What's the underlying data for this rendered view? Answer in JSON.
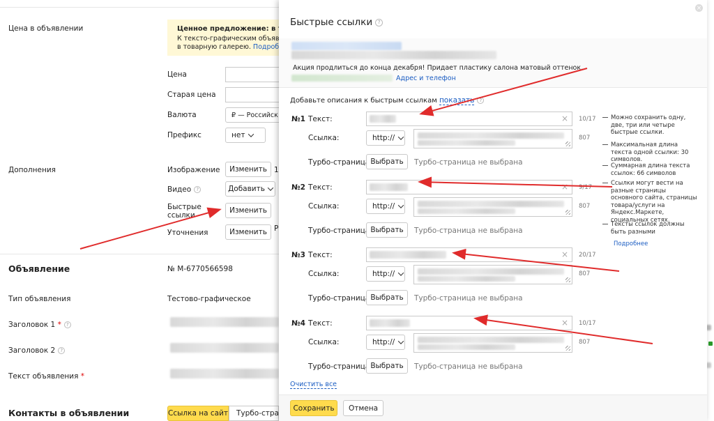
{
  "background": {
    "price_section_label": "Цена в объявлении",
    "valuable_offer_title": "Ценное предложение: в тексте",
    "valuable_offer_line1": "К тексто-графическим объявле",
    "valuable_offer_line2": "в товарную галерею.",
    "valuable_offer_link": "Подробне",
    "price_label": "Цена",
    "old_price_label": "Старая цена",
    "currency_label": "Валюта",
    "currency_value": "₽ — Российск",
    "prefix_label": "Префикс",
    "prefix_value": "нет",
    "additions_label": "Дополнения",
    "image_label": "Изображение",
    "image_button": "Изменить",
    "image_extra": "1",
    "video_label": "Видео",
    "video_button": "Добавить",
    "quicklinks_label_1": "Быстрые",
    "quicklinks_label_2": "ссылки",
    "quicklinks_button": "Изменить",
    "clarifications_label": "Уточнения",
    "clarifications_button": "Изменить",
    "clarifications_extra": "Р",
    "ad_section_title": "Объявление",
    "ad_number": "№ M-6770566598",
    "ad_type_label": "Тип объявления",
    "ad_type_value": "Тестово-графическое",
    "headline1_label": "Заголовок 1",
    "headline2_label": "Заголовок 2",
    "ad_text_label": "Текст объявления",
    "contacts_title": "Контакты в объявлении",
    "contacts_tab_site": "Ссылка на сайт",
    "contacts_tab_turbo": "Турбо-страни"
  },
  "modal": {
    "title": "Быстрые ссылки",
    "preview_text": "Акция продлиться до конца декабря! Придает пластику салона матовый оттенок.",
    "preview_link": "Адрес и телефон",
    "add_descriptions": "Добавьте описания к быстрым ссылкам",
    "show_link": "показать",
    "text_label": "Текст:",
    "url_label": "Ссылка:",
    "turbo_label": "Турбо-страница:",
    "protocol": "http://",
    "choose_button": "Выбрать",
    "turbo_none": "Турбо-страница не выбрана",
    "url_counter": "807",
    "links": [
      {
        "num": "№1",
        "counter": "10/17"
      },
      {
        "num": "№2",
        "counter": "9/17"
      },
      {
        "num": "№3",
        "counter": "20/17"
      },
      {
        "num": "№4",
        "counter": "10/17"
      }
    ],
    "hints": [
      "Можно сохранить одну, две, три или четыре быстрые ссылки.",
      "Максимальная длина текста одной ссылки: 30 символов.",
      "Суммарная длина текста ссылок: 66 символов",
      "Ссылки могут вести на разные страницы основного сайта, страницы товара/услуги на Яндекс.Маркете, социальных сетях.",
      "Тексты ссылок должны быть разными"
    ],
    "more_link": "Подробнее",
    "clear_all": "Очистить все",
    "save_button": "Сохранить",
    "cancel_button": "Отмена"
  },
  "colors": {
    "accent_yellow": "#ffdb4d",
    "note_bg": "#fff8d6",
    "link_blue": "#1a5cc2",
    "arrow_red": "#e02b2b"
  }
}
